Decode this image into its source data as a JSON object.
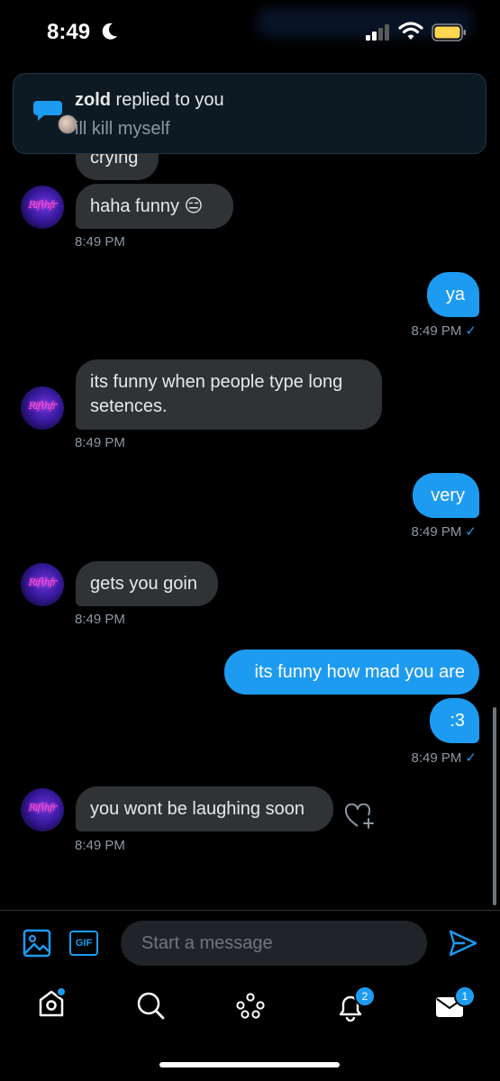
{
  "status_bar": {
    "time": "8:49"
  },
  "notification": {
    "user": "zold",
    "action": " replied to you",
    "text": "ill kill myself"
  },
  "messages": [
    {
      "dir": "in",
      "text": "crying"
    },
    {
      "dir": "in",
      "text": "haha funny 😑",
      "time": "8:49 PM"
    },
    {
      "dir": "out",
      "text": "ya",
      "time": "8:49 PM"
    },
    {
      "dir": "in",
      "text": "its funny when people type long setences.",
      "time": "8:49 PM"
    },
    {
      "dir": "out",
      "text": "very",
      "time": "8:49 PM"
    },
    {
      "dir": "in",
      "text": "gets you goin",
      "time": "8:49 PM"
    },
    {
      "dir": "out",
      "text": "its funny how mad you are"
    },
    {
      "dir": "out",
      "text": ":3",
      "time": "8:49 PM"
    },
    {
      "dir": "in",
      "text": "you wont be laughing soon",
      "time": "8:49 PM"
    }
  ],
  "composer": {
    "placeholder": "Start a message",
    "gif_label": "GIF"
  },
  "nav": {
    "notifications_badge": "2",
    "messages_badge": "1"
  },
  "colors": {
    "accent": "#1d9bf0",
    "incoming_bubble": "#2f3336",
    "background": "#000000"
  },
  "icons": [
    "moon-icon",
    "signal-icon",
    "wifi-icon",
    "battery-icon",
    "reply-bubble-icon",
    "image-icon",
    "gif-icon",
    "send-icon",
    "home-icon",
    "search-icon",
    "spaces-icon",
    "bell-icon",
    "mail-icon",
    "heart-add-icon"
  ]
}
